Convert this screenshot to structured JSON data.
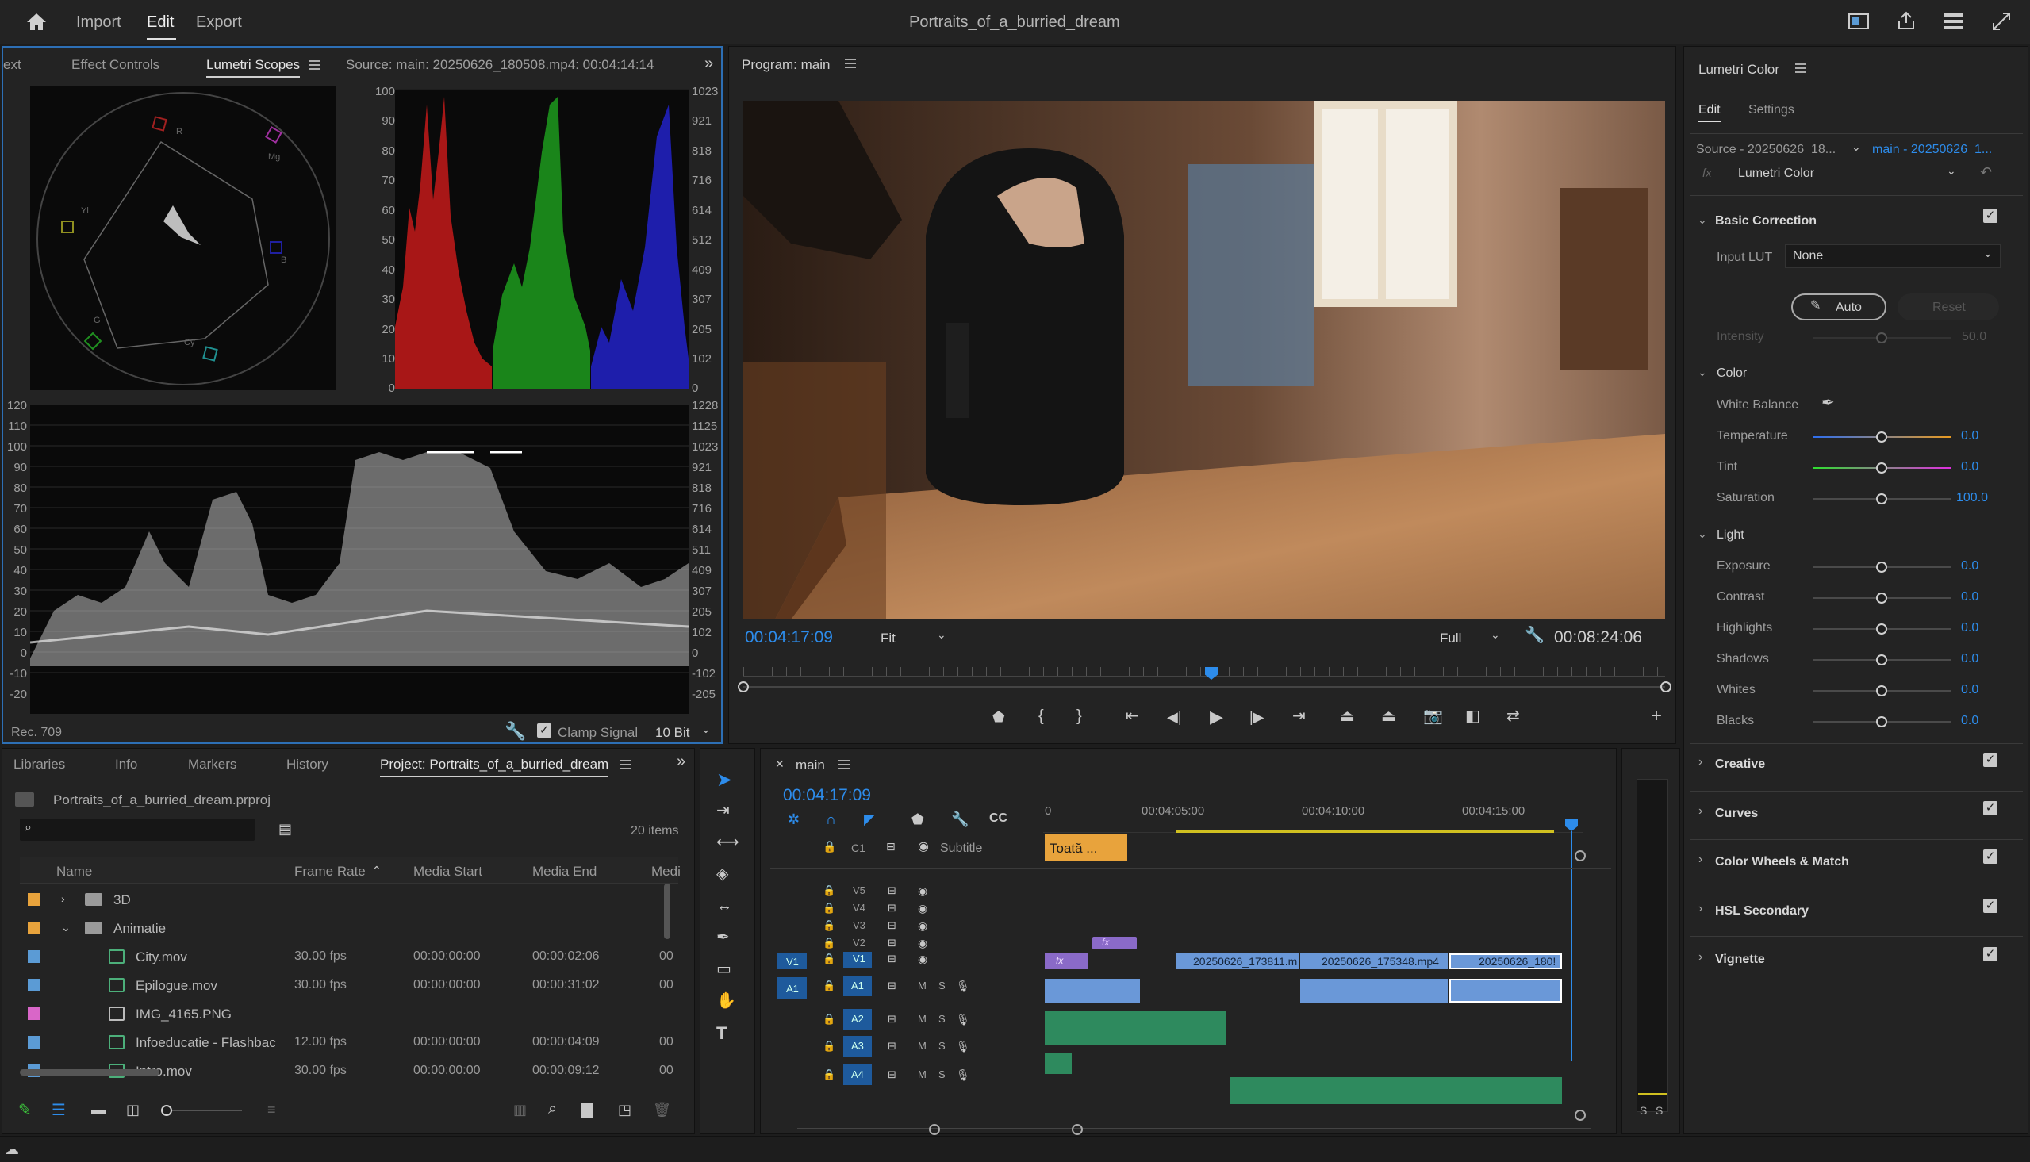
{
  "app": {
    "title": "Portraits_of_a_burried_dream",
    "menu": [
      "Import",
      "Edit",
      "Export"
    ],
    "active_menu": "Edit"
  },
  "scopes": {
    "tabs": [
      "ext",
      "Effect Controls",
      "Lumetri Scopes"
    ],
    "source": "Source: main: 20250626_180508.mp4: 00:04:14:14",
    "vs_labels": [
      "R",
      "Mg",
      "B",
      "Cy",
      "G",
      "Yl"
    ],
    "parade_left": [
      "100",
      "90",
      "80",
      "70",
      "60",
      "50",
      "40",
      "30",
      "20",
      "10",
      "0"
    ],
    "parade_right": [
      "1023",
      "921",
      "818",
      "716",
      "614",
      "512",
      "409",
      "307",
      "205",
      "102",
      "0"
    ],
    "wave_left": [
      "120",
      "110",
      "100",
      "90",
      "80",
      "70",
      "60",
      "50",
      "40",
      "30",
      "20",
      "10",
      "0",
      "-10",
      "-20"
    ],
    "wave_right": [
      "1228",
      "1125",
      "1023",
      "921",
      "818",
      "716",
      "614",
      "511",
      "409",
      "307",
      "205",
      "102",
      "0",
      "-102",
      "-205"
    ],
    "rec": "Rec. 709",
    "clamp": "Clamp Signal",
    "bits": "10 Bit"
  },
  "program": {
    "title": "Program: main",
    "timecode": "00:04:17:09",
    "fit": "Fit",
    "full": "Full",
    "duration": "00:08:24:06"
  },
  "lumetri": {
    "title": "Lumetri Color",
    "tabs": [
      "Edit",
      "Settings"
    ],
    "source": "Source - 20250626_18...",
    "target": "main - 20250626_1...",
    "fx": "Lumetri Color",
    "basic": "Basic Correction",
    "input_lut_label": "Input LUT",
    "input_lut": "None",
    "auto": "Auto",
    "reset": "Reset",
    "intensity_label": "Intensity",
    "intensity": "50.0",
    "color": "Color",
    "white_balance": "White Balance",
    "temperature_label": "Temperature",
    "temperature": "0.0",
    "tint_label": "Tint",
    "tint": "0.0",
    "saturation_label": "Saturation",
    "saturation": "100.0",
    "light": "Light",
    "exposure_label": "Exposure",
    "exposure": "0.0",
    "contrast_label": "Contrast",
    "contrast": "0.0",
    "highlights_label": "Highlights",
    "highlights": "0.0",
    "shadows_label": "Shadows",
    "shadows": "0.0",
    "whites_label": "Whites",
    "whites": "0.0",
    "blacks_label": "Blacks",
    "blacks": "0.0",
    "sections": [
      "Creative",
      "Curves",
      "Color Wheels & Match",
      "HSL Secondary",
      "Vignette"
    ]
  },
  "project": {
    "tabs": [
      "Libraries",
      "Info",
      "Markers",
      "History",
      "Project: Portraits_of_a_burried_dream"
    ],
    "file": "Portraits_of_a_burried_dream.prproj",
    "items": "20 items",
    "cols": [
      "Name",
      "Frame Rate",
      "Media Start",
      "Media End",
      "Medi"
    ],
    "rows": [
      {
        "color": "#e8a33c",
        "name": "3D",
        "rate": "",
        "start": "",
        "end": "",
        "m": "",
        "type": "folder",
        "indent": 0
      },
      {
        "color": "#e8a33c",
        "name": "Animatie",
        "rate": "",
        "start": "",
        "end": "",
        "m": "",
        "type": "folder-open",
        "indent": 0
      },
      {
        "color": "#5b9bd5",
        "name": "City.mov",
        "rate": "30.00 fps",
        "start": "00:00:00:00",
        "end": "00:00:02:06",
        "m": "00",
        "type": "clip",
        "indent": 1
      },
      {
        "color": "#5b9bd5",
        "name": "Epilogue.mov",
        "rate": "30.00 fps",
        "start": "00:00:00:00",
        "end": "00:00:31:02",
        "m": "00",
        "type": "clip",
        "indent": 1
      },
      {
        "color": "#d966c8",
        "name": "IMG_4165.PNG",
        "rate": "",
        "start": "",
        "end": "",
        "m": "",
        "type": "image",
        "indent": 1
      },
      {
        "color": "#5b9bd5",
        "name": "Infoeducatie - Flashbac",
        "rate": "12.00 fps",
        "start": "00:00:00:00",
        "end": "00:00:04:09",
        "m": "00",
        "type": "clip",
        "indent": 1
      },
      {
        "color": "#5b9bd5",
        "name": "Intro.mov",
        "rate": "30.00 fps",
        "start": "00:00:00:00",
        "end": "00:00:09:12",
        "m": "00",
        "type": "clip",
        "indent": 1
      }
    ]
  },
  "timeline": {
    "title": "main",
    "timecode": "00:04:17:09",
    "ruler": [
      "0",
      "00:04:05:00",
      "00:04:10:00",
      "00:04:15:00"
    ],
    "subtitle_track": "C1",
    "subtitle_label": "Subtitle",
    "subtitle_clip": "Toată ...",
    "vtracks": [
      "V5",
      "V4",
      "V3",
      "V2",
      "V1"
    ],
    "atracks": [
      "A1",
      "A2",
      "A3",
      "A4"
    ],
    "clips": [
      "20250626_173811.m",
      "20250626_175348.mp4",
      "20250626_180!"
    ],
    "fx": "fx",
    "m": "M",
    "s": "S"
  },
  "meter": {
    "s1": "S",
    "s2": "S"
  }
}
